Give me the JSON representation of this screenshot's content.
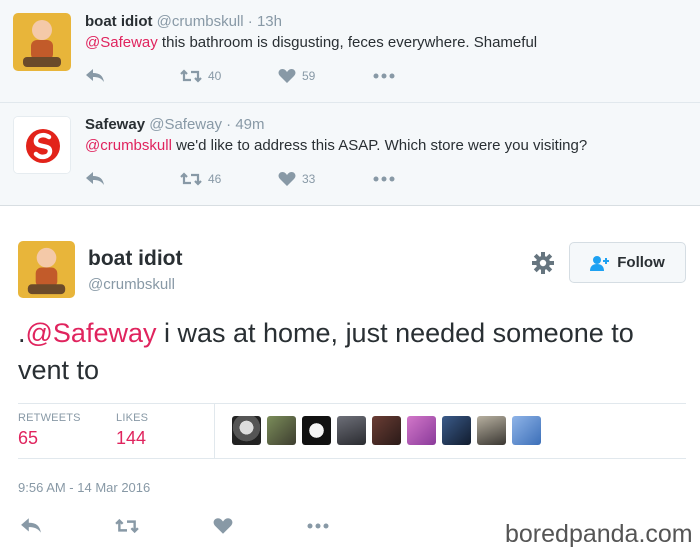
{
  "replies": [
    {
      "name": "boat idiot",
      "handle": "@crumbskull",
      "separator": "·",
      "time": "13h",
      "mention": "@Safeway",
      "text": " this bathroom is disgusting, feces everywhere. Shameful",
      "retweets": "40",
      "likes": "59"
    },
    {
      "name": "Safeway",
      "handle": "@Safeway",
      "separator": "·",
      "time": "49m",
      "mention": "@crumbskull",
      "text": " we'd like to address this ASAP. Which store were you visiting?",
      "retweets": "46",
      "likes": "33"
    }
  ],
  "main": {
    "name": "boat idiot",
    "handle": "@crumbskull",
    "follow_label": "Follow",
    "text_prefix": ".",
    "mention": "@Safeway",
    "text": " i was at home, just needed someone to vent to",
    "retweets_label": "RETWEETS",
    "retweets": "65",
    "likes_label": "LIKES",
    "likes": "144",
    "timestamp": "9:56 AM - 14 Mar 2016"
  },
  "icons": {
    "reply": "reply-icon",
    "retweet": "retweet-icon",
    "like": "heart-icon",
    "more": "more-icon",
    "gear": "gear-icon",
    "follow": "add-user-icon"
  },
  "colors": {
    "accent": "#e0245e",
    "muted": "#8899a6",
    "text": "#292f33",
    "reply_bg": "#f5f8fa"
  },
  "watermark": "boredpanda.com"
}
